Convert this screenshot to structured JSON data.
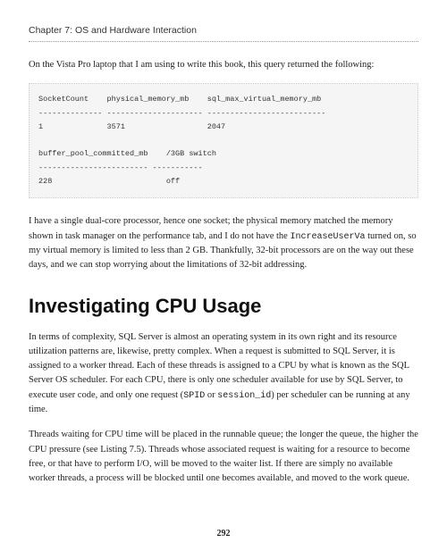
{
  "chapter_header": "Chapter 7: OS and Hardware Interaction",
  "intro_para": "On the Vista Pro laptop that I am using to write this book, this query returned the following:",
  "code_output": "SocketCount    physical_memory_mb    sql_max_virtual_memory_mb\n-------------- --------------------- --------------------------\n1              3571                  2047\n\nbuffer_pool_committed_mb    /3GB switch\n------------------------ -----------\n228                         off",
  "para2_part1": "I have a single dual-core processor, hence one socket; the physical memory matched the memory shown in task manager on the performance tab, and I do not have the ",
  "para2_code": "IncreaseUserVa",
  "para2_part2": " turned on, so my virtual memory is limited to less than 2 GB. Thankfully, 32-bit processors are on the way out these days, and we can stop worrying about the limitations of 32-bit addressing.",
  "heading": "Investigating CPU Usage",
  "para3_part1": "In terms of complexity, SQL Server is almost an operating system in its own right and its resource utilization patterns are, likewise, pretty complex. When a request is submitted to SQL Server, it is assigned to a worker thread. Each of these threads is assigned to a CPU by what is known as the SQL Server OS scheduler. For each CPU, there is only one scheduler available for use by SQL Server, to execute user code, and only one request (",
  "para3_code1": "SPID",
  "para3_mid": " or ",
  "para3_code2": "session_id",
  "para3_part2": ") per scheduler can be running at any time.",
  "para4": "Threads waiting for CPU time will be placed in the runnable queue; the longer the queue, the higher the CPU pressure (see Listing 7.5). Threads whose associated request is waiting for a resource to become free, or that have to perform I/O, will be moved to the waiter list. If there are simply no available worker threads, a process will be blocked until one becomes available, and moved to the work queue.",
  "page_number": "292"
}
